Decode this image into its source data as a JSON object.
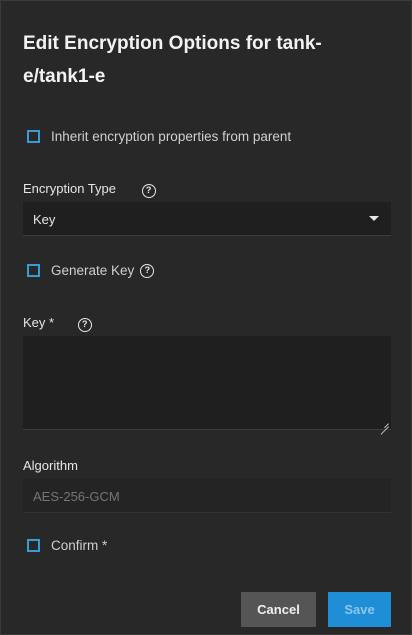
{
  "dialog": {
    "title": "Edit Encryption Options for tank-e/tank1-e"
  },
  "inherit": {
    "label": "Inherit encryption properties from parent",
    "checked": false
  },
  "encryption_type": {
    "label": "Encryption Type",
    "help_icon": "help-circle-icon",
    "value": "Key"
  },
  "generate_key": {
    "label": "Generate Key",
    "help_icon": "help-circle-icon",
    "checked": false
  },
  "key": {
    "label": "Key *",
    "help_icon": "help-circle-icon",
    "value": ""
  },
  "algorithm": {
    "label": "Algorithm",
    "value": "AES-256-GCM"
  },
  "confirm": {
    "label": "Confirm *",
    "checked": false
  },
  "actions": {
    "cancel_label": "Cancel",
    "save_label": "Save"
  },
  "colors": {
    "accent": "#1e8fd6",
    "checkbox_border": "#3a9bd9",
    "background": "#282828"
  }
}
